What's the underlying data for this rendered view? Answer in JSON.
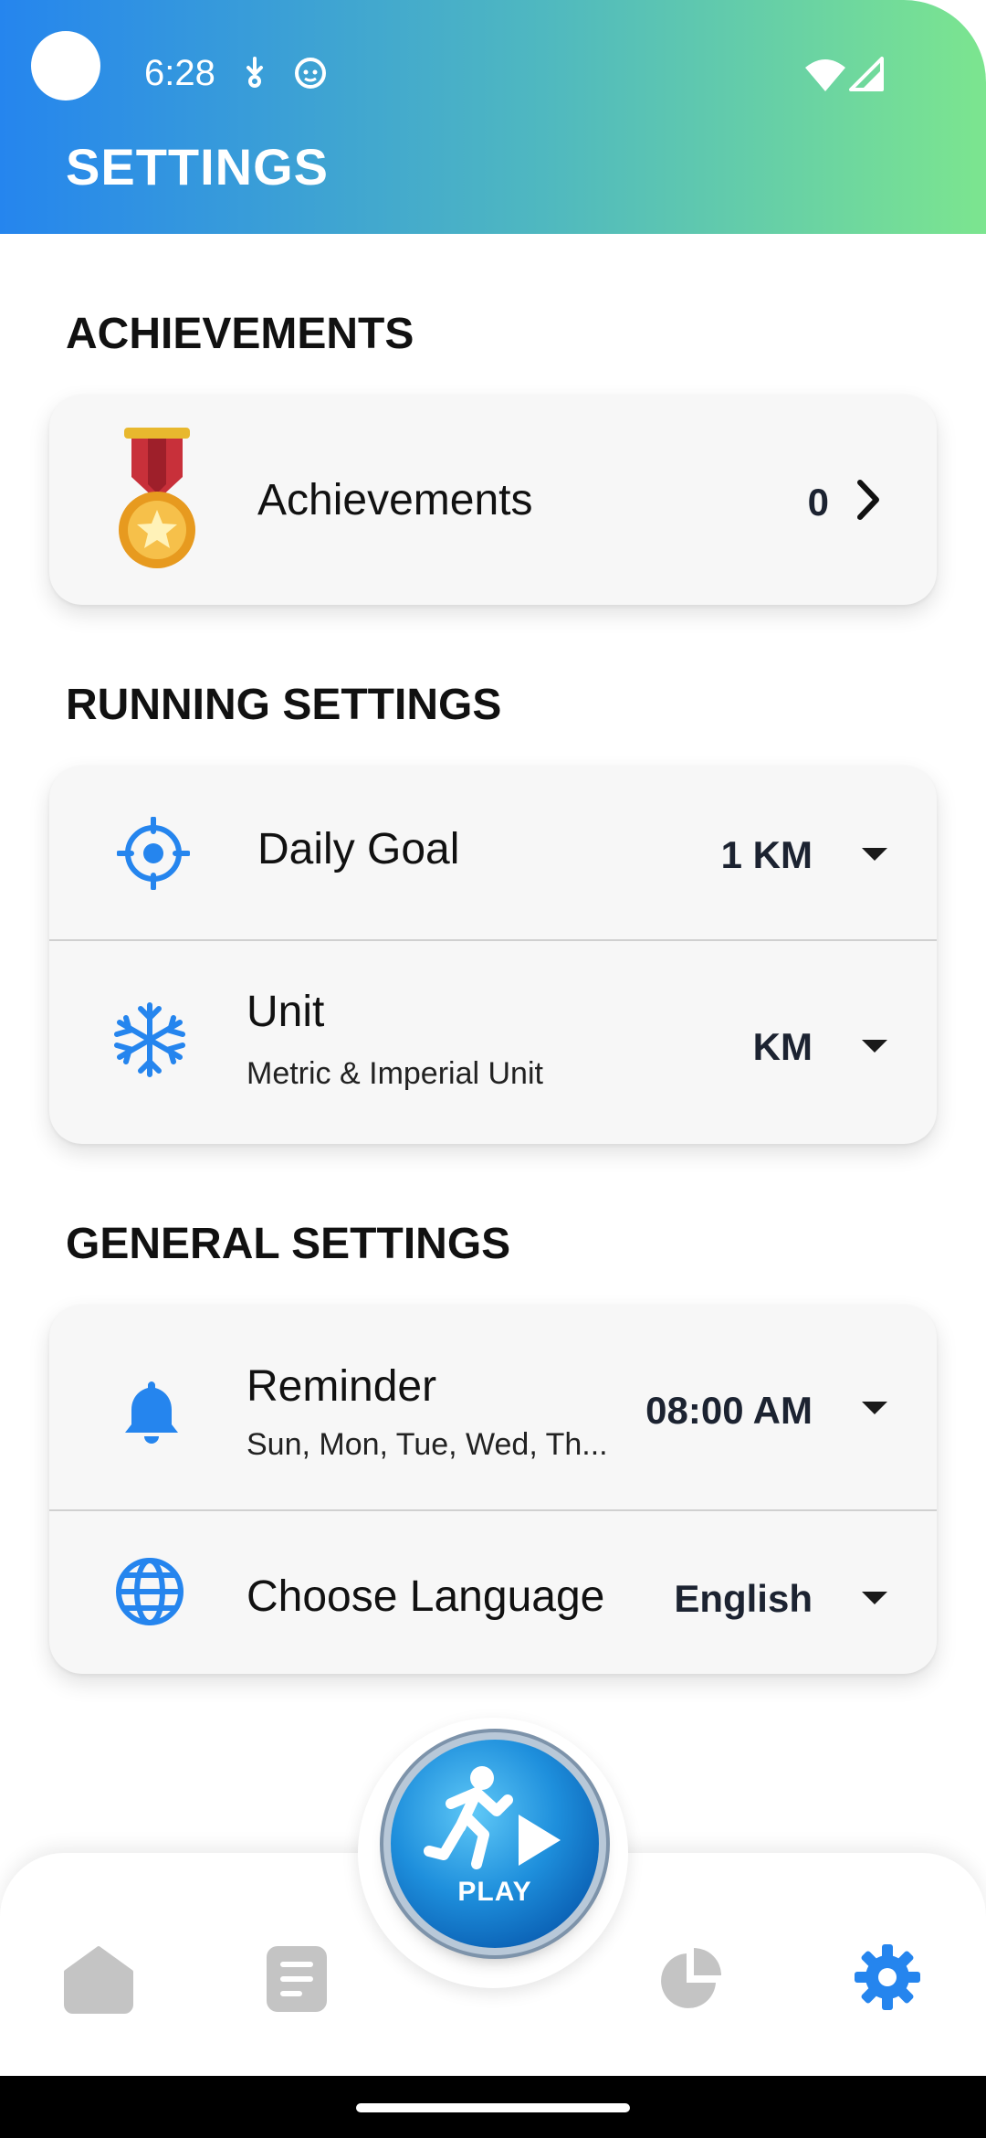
{
  "status_bar": {
    "time": "6:28"
  },
  "header": {
    "title": "SETTINGS"
  },
  "sections": {
    "achievements": {
      "title": "ACHIEVEMENTS",
      "item": {
        "label": "Achievements",
        "value": "0",
        "icon": "medal-icon"
      }
    },
    "running": {
      "title": "RUNNING SETTINGS",
      "daily_goal": {
        "label": "Daily Goal",
        "value": "1 KM",
        "icon": "target-icon"
      },
      "unit": {
        "label": "Unit",
        "subtitle": "Metric & Imperial Unit",
        "value": "KM",
        "icon": "snowflake-icon"
      }
    },
    "general": {
      "title": "GENERAL SETTINGS",
      "reminder": {
        "label": "Reminder",
        "subtitle": "Sun, Mon, Tue, Wed, Th...",
        "value": "08:00 AM",
        "icon": "bell-icon"
      },
      "language": {
        "label": "Choose Language",
        "value": "English",
        "icon": "globe-icon"
      }
    }
  },
  "bottom_nav": {
    "play_label": "PLAY",
    "items": [
      "home-icon",
      "document-icon",
      "pie-chart-icon",
      "gear-icon"
    ],
    "active": "gear-icon"
  },
  "colors": {
    "accent": "#2585ee",
    "header_end": "#7ce58f",
    "inactive": "#c4c4c4"
  }
}
